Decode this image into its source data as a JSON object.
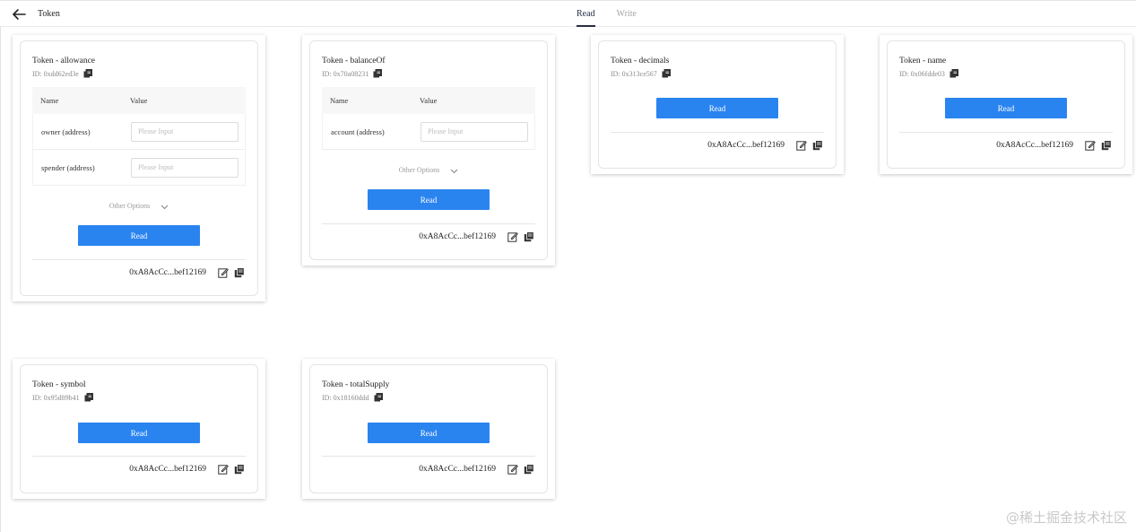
{
  "header": {
    "title": "Token",
    "tabs": [
      {
        "label": "Read",
        "active": true
      },
      {
        "label": "Write",
        "active": false
      }
    ]
  },
  "common": {
    "name_header": "Name",
    "value_header": "Value",
    "placeholder": "Please Input",
    "other_options": "Other Options",
    "read_label": "Read",
    "address": "0xA8AcCc...bef12169"
  },
  "cards": {
    "allowance": {
      "title": "Token - allowance",
      "id": "ID: 0xdd62ed3e",
      "params": [
        "owner (address)",
        "spender (address)"
      ]
    },
    "balanceOf": {
      "title": "Token - balanceOf",
      "id": "ID: 0x70a08231",
      "params": [
        "account (address)"
      ]
    },
    "decimals": {
      "title": "Token - decimals",
      "id": "ID: 0x313ce567"
    },
    "name": {
      "title": "Token - name",
      "id": "ID: 0x06fdde03"
    },
    "symbol": {
      "title": "Token - symbol",
      "id": "ID: 0x95d89b41"
    },
    "totalSupply": {
      "title": "Token - totalSupply",
      "id": "ID: 0x18160ddd"
    }
  },
  "watermark": "@稀土掘金技术社区",
  "colors": {
    "accent": "#2a84f0",
    "tab_active": "#2b2d42"
  }
}
